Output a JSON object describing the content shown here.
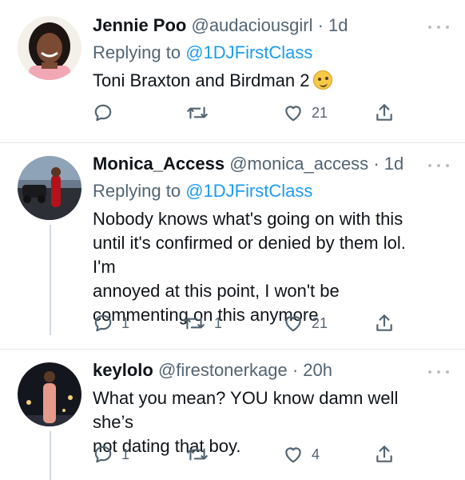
{
  "tweets": [
    {
      "name": "Jennie Poo",
      "handle": "@audaciousgirl",
      "dot": "·",
      "time": "1d",
      "replying_prefix": "Replying to ",
      "replying_to": "@1DJFirstClass",
      "text": "Toni Braxton and Birdman 2",
      "emoji": "woozy-face-emoji",
      "actions": {
        "reply": "",
        "retweet": "",
        "like": "21"
      }
    },
    {
      "name": "Monica_Access",
      "handle": "@monica_access",
      "dot": "·",
      "time": "1d",
      "replying_prefix": "Replying to ",
      "replying_to": "@1DJFirstClass",
      "text_lines": [
        "Nobody knows what's going on with this",
        "until it's confirmed or denied by them lol. I'm",
        "annoyed at this point, I won't be",
        "commenting on this anymore"
      ],
      "actions": {
        "reply": "1",
        "retweet": "1",
        "like": "21"
      }
    },
    {
      "name": "keylolo",
      "handle": "@firestonerkage",
      "dot": "·",
      "time": "20h",
      "text_lines": [
        "What you mean? YOU know damn well she’s",
        "not dating that boy."
      ],
      "actions": {
        "reply": "1",
        "retweet": "",
        "like": "4"
      }
    }
  ],
  "colors": {
    "text": "#0f1419",
    "secondary": "#536471",
    "link": "#1d9bf0",
    "divider": "#e4e8eb"
  },
  "icons": [
    "reply-icon",
    "retweet-icon",
    "like-icon",
    "share-icon",
    "more-icon"
  ]
}
